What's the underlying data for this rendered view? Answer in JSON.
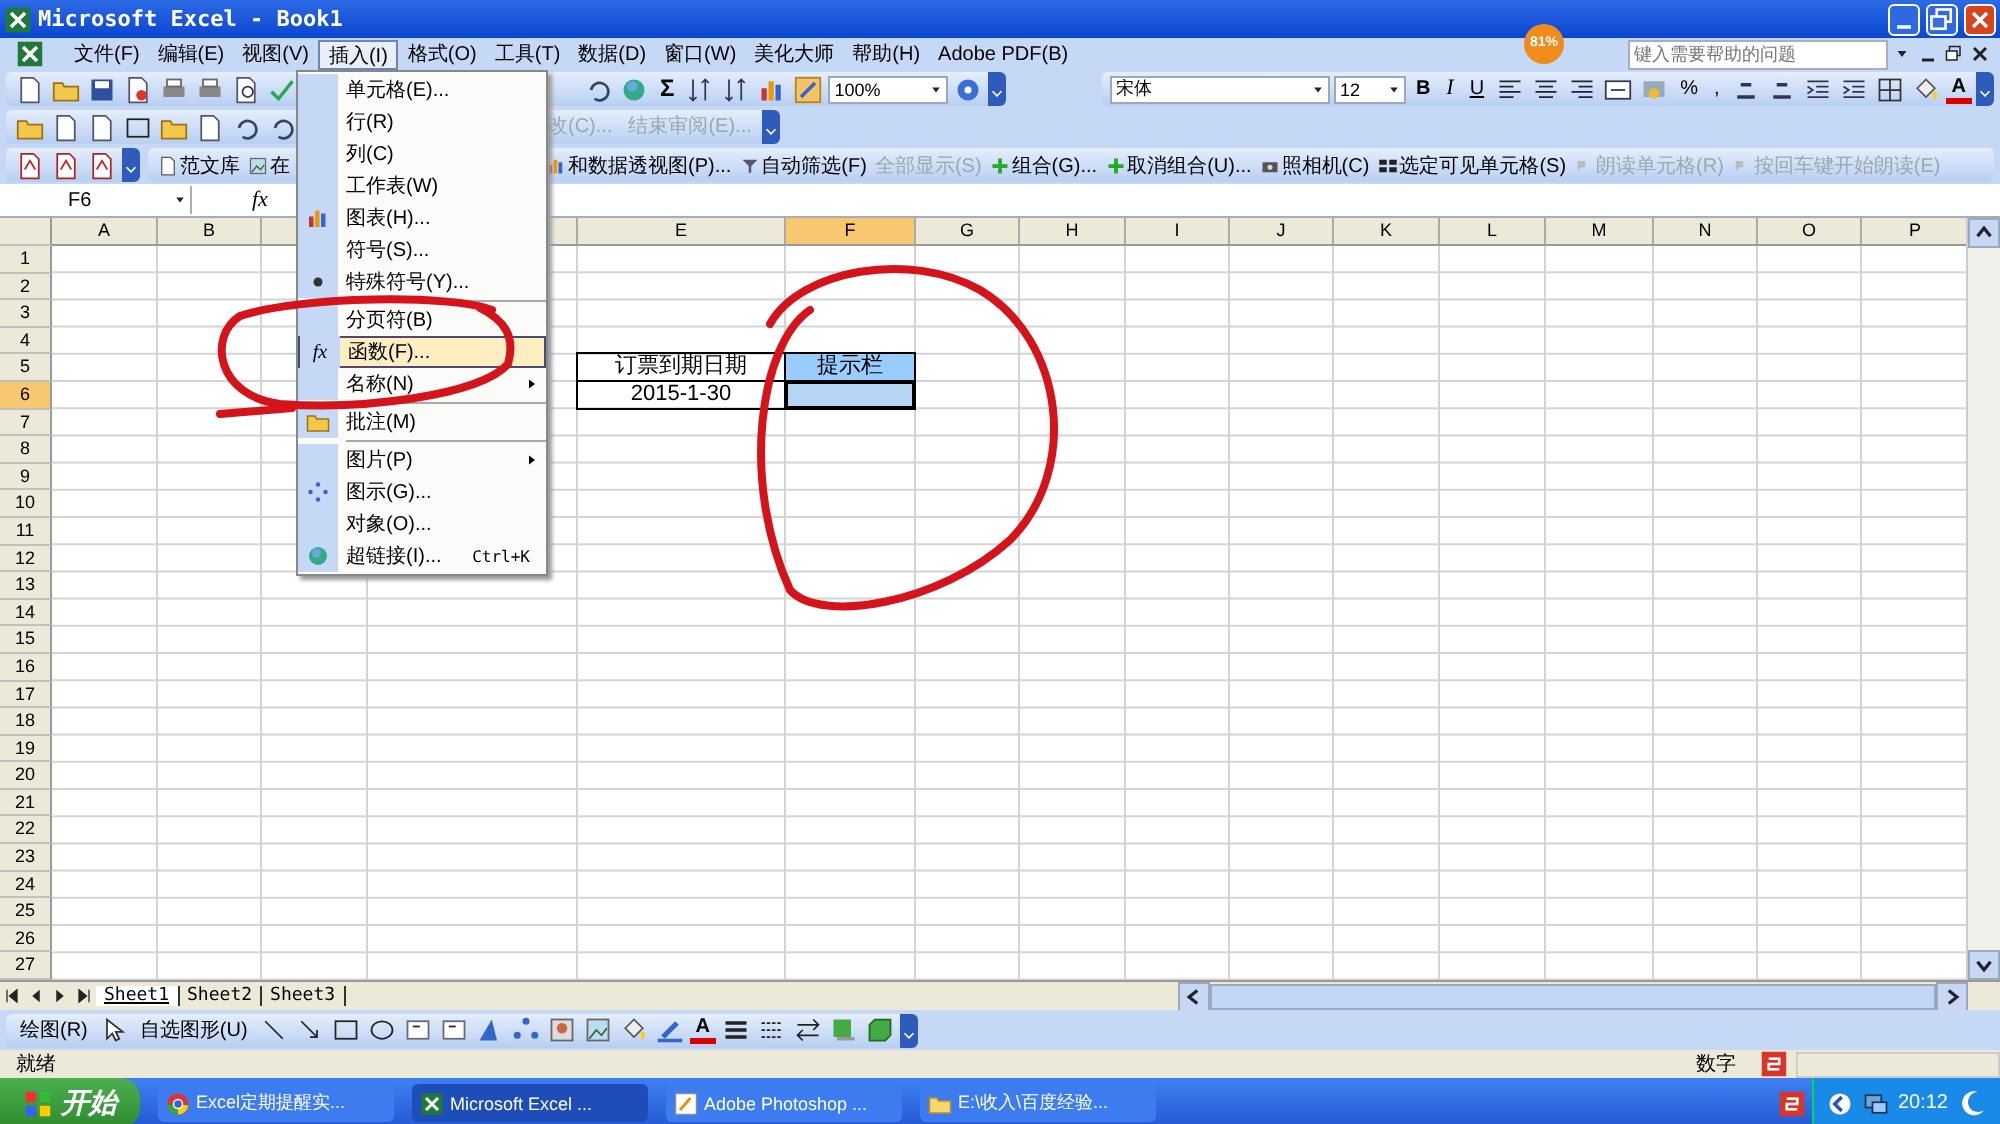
{
  "window": {
    "title": "Microsoft Excel - Book1"
  },
  "menu_bar": {
    "items": [
      {
        "label": "文件(F)",
        "selected": false
      },
      {
        "label": "编辑(E)",
        "selected": false
      },
      {
        "label": "视图(V)",
        "selected": false
      },
      {
        "label": "插入(I)",
        "selected": true
      },
      {
        "label": "格式(O)",
        "selected": false
      },
      {
        "label": "工具(T)",
        "selected": false
      },
      {
        "label": "数据(D)",
        "selected": false
      },
      {
        "label": "窗口(W)",
        "selected": false
      },
      {
        "label": "美化大师",
        "selected": false
      },
      {
        "label": "帮助(H)",
        "selected": false
      },
      {
        "label": "Adobe PDF(B)",
        "selected": false
      }
    ],
    "help_field": {
      "placeholder": "键入需要帮助的问题"
    }
  },
  "insert_menu": {
    "items": [
      {
        "label": "单元格(E)...",
        "selected": false,
        "separator_before": false,
        "submenu": false
      },
      {
        "label": "行(R)",
        "selected": false,
        "separator_before": false,
        "submenu": false
      },
      {
        "label": "列(C)",
        "selected": false,
        "separator_before": false,
        "submenu": false
      },
      {
        "label": "工作表(W)",
        "selected": false,
        "separator_before": false,
        "submenu": false
      },
      {
        "label": "图表(H)...",
        "selected": false,
        "separator_before": false,
        "submenu": false
      },
      {
        "label": "符号(S)...",
        "selected": false,
        "separator_before": false,
        "submenu": false
      },
      {
        "label": "特殊符号(Y)...",
        "selected": false,
        "separator_before": false,
        "submenu": false
      },
      {
        "label": "分页符(B)",
        "selected": false,
        "separator_before": true,
        "submenu": false
      },
      {
        "label": "函数(F)...",
        "selected": true,
        "separator_before": false,
        "submenu": false,
        "glyph": "fx"
      },
      {
        "label": "名称(N)",
        "selected": false,
        "separator_before": false,
        "submenu": true
      },
      {
        "label": "批注(M)",
        "selected": false,
        "separator_before": true,
        "submenu": false
      },
      {
        "label": "图片(P)",
        "selected": false,
        "separator_before": true,
        "submenu": true
      },
      {
        "label": "图示(G)...",
        "selected": false,
        "separator_before": false,
        "submenu": false
      },
      {
        "label": "对象(O)...",
        "selected": false,
        "separator_before": false,
        "submenu": false
      },
      {
        "label": "超链接(I)...",
        "selected": false,
        "separator_before": false,
        "submenu": false,
        "shortcut": "Ctrl+K"
      }
    ]
  },
  "standard_toolbar": {
    "sigma": "Σ",
    "zoom": "100%"
  },
  "formatting_toolbar": {
    "font": "宋体",
    "size": "12",
    "bold": "B",
    "italic": "I",
    "underline": "U",
    "percent": "%",
    "comma": ",",
    "font_color": "A"
  },
  "reviewing_toolbar": {
    "items": [
      "改(C)...",
      "结束审阅(E)..."
    ]
  },
  "extra_toolbar": {
    "items": [
      {
        "label": "范文库",
        "disabled": false
      },
      {
        "label": "在",
        "disabled": false
      },
      {
        "label": "和数据透视图(P)...",
        "disabled": false
      },
      {
        "label": "自动筛选(F)",
        "disabled": false
      },
      {
        "label": "全部显示(S)",
        "disabled": true
      },
      {
        "label": "组合(G)...",
        "disabled": false
      },
      {
        "label": "取消组合(U)...",
        "disabled": false
      },
      {
        "label": "照相机(C)",
        "disabled": false
      },
      {
        "label": "选定可见单元格(S)",
        "disabled": false
      },
      {
        "label": "朗读单元格(R)",
        "disabled": true
      },
      {
        "label": "按回车键开始朗读(E)",
        "disabled": true
      }
    ]
  },
  "formula_bar": {
    "name_box": "F6",
    "function_label": "fx"
  },
  "sheet": {
    "columns": [
      "A",
      "B",
      "E",
      "F",
      "G",
      "H",
      "I",
      "J",
      "K",
      "L",
      "M",
      "N",
      "O",
      "P"
    ],
    "rows": [
      {
        "label": "1"
      },
      {
        "label": "2"
      },
      {
        "label": "3"
      },
      {
        "label": "4"
      },
      {
        "label": "5",
        "cells": [
          {
            "text": "订票到期日期",
            "selected": false
          },
          {
            "text": "提示栏",
            "selected": false,
            "color": "#99ccff"
          }
        ]
      },
      {
        "label": "6",
        "cells": [
          {
            "text": "2015-1-30",
            "selected": false
          },
          {
            "selected": true
          }
        ]
      },
      {
        "label": "7"
      },
      {
        "label": "8"
      },
      {
        "label": "9"
      },
      {
        "label": "10"
      },
      {
        "label": "11"
      },
      {
        "label": "12"
      },
      {
        "label": "13"
      },
      {
        "label": "14"
      },
      {
        "label": "15"
      },
      {
        "label": "16"
      },
      {
        "label": "17"
      },
      {
        "label": "18"
      },
      {
        "label": "19"
      },
      {
        "label": "20"
      },
      {
        "label": "21"
      },
      {
        "label": "22"
      },
      {
        "label": "23"
      },
      {
        "label": "24"
      },
      {
        "label": "25"
      },
      {
        "label": "26"
      },
      {
        "label": "27"
      }
    ]
  },
  "sheet_tabs": [
    {
      "label": "Sheet1",
      "selected": true
    },
    {
      "label": "Sheet2",
      "selected": false
    },
    {
      "label": "Sheet3",
      "selected": false
    }
  ],
  "drawing_toolbar": {
    "draw": "绘图(R)",
    "autoshapes": "自选图形(U)",
    "font_color": "A"
  },
  "status_bar": {
    "text": "就绪",
    "mode": "数字"
  },
  "badge": {
    "text": "81%"
  },
  "taskbar": {
    "start": "开始",
    "tasks": [
      {
        "label": "Excel定期提醒实...",
        "selected": false
      },
      {
        "label": "Microsoft Excel ...",
        "selected": true
      },
      {
        "label": "Adobe Photoshop ...",
        "selected": false
      },
      {
        "label": "E:\\收入\\百度经验...",
        "selected": false
      }
    ],
    "clock": "20:12"
  }
}
